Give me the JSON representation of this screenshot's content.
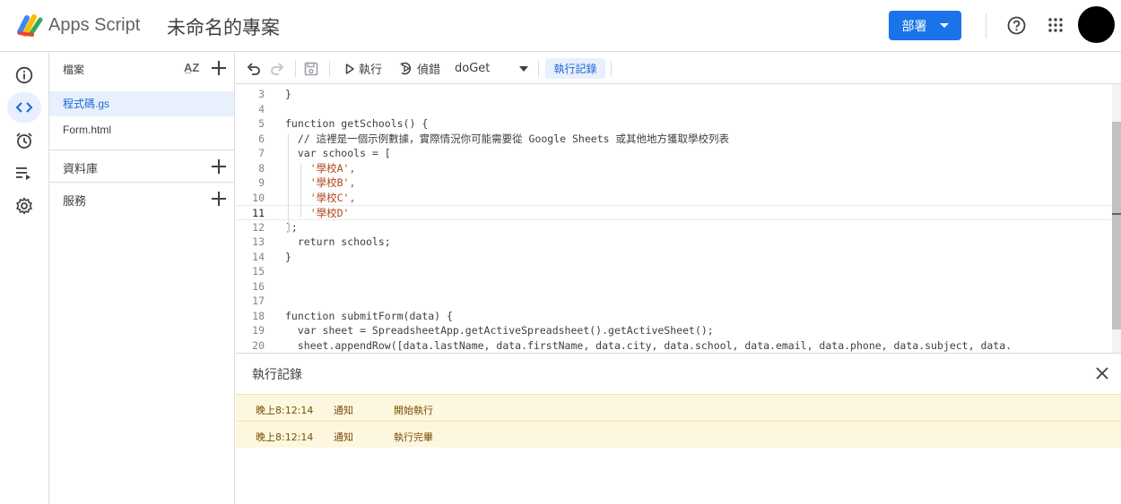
{
  "header": {
    "app_name": "Apps Script",
    "project_name": "未命名的專案",
    "deploy_label": "部署"
  },
  "rail": {
    "items": [
      "info-icon",
      "code-icon",
      "clock-icon",
      "executions-icon",
      "gear-icon"
    ],
    "active": "code-icon"
  },
  "files": {
    "title": "檔案",
    "items": [
      {
        "name": "程式碼.gs",
        "active": true
      },
      {
        "name": "Form.html",
        "active": false
      }
    ],
    "sections": [
      {
        "label": "資料庫"
      },
      {
        "label": "服務"
      }
    ]
  },
  "toolbar": {
    "run_label": "執行",
    "debug_label": "偵錯",
    "function_name": "doGet",
    "log_label": "執行記錄"
  },
  "editor": {
    "lines": [
      {
        "n": "3",
        "text": "}"
      },
      {
        "n": "4",
        "text": ""
      },
      {
        "n": "5",
        "text": "function getSchools() {"
      },
      {
        "n": "6",
        "text": "  // 這裡是一個示例數據，實際情況你可能需要從 Google Sheets 或其他地方獲取學校列表"
      },
      {
        "n": "7",
        "text": "  var schools = ["
      },
      {
        "n": "8",
        "text": "    '學校A',"
      },
      {
        "n": "9",
        "text": "    '學校B',"
      },
      {
        "n": "10",
        "text": "    '學校C',"
      },
      {
        "n": "11",
        "text": "    '學校D'"
      },
      {
        "n": "12",
        "text": "];"
      },
      {
        "n": "13",
        "text": "  return schools;"
      },
      {
        "n": "14",
        "text": "}"
      },
      {
        "n": "15",
        "text": ""
      },
      {
        "n": "16",
        "text": ""
      },
      {
        "n": "17",
        "text": ""
      },
      {
        "n": "18",
        "text": "function submitForm(data) {"
      },
      {
        "n": "19",
        "text": "  var sheet = SpreadsheetApp.getActiveSpreadsheet().getActiveSheet();"
      },
      {
        "n": "20",
        "text": "  sheet.appendRow([data.lastName, data.firstName, data.city, data.school, data.email, data.phone, data.subject, data."
      }
    ],
    "current_line": "11"
  },
  "log": {
    "title": "執行記錄",
    "rows": [
      {
        "time": "晚上8:12:14",
        "level": "通知",
        "message": "開始執行"
      },
      {
        "time": "晚上8:12:14",
        "level": "通知",
        "message": "執行完畢"
      }
    ]
  },
  "colors": {
    "accent": "#1a73e8",
    "active_bg": "#e8f0fe",
    "log_row_bg": "#fef7e0"
  }
}
